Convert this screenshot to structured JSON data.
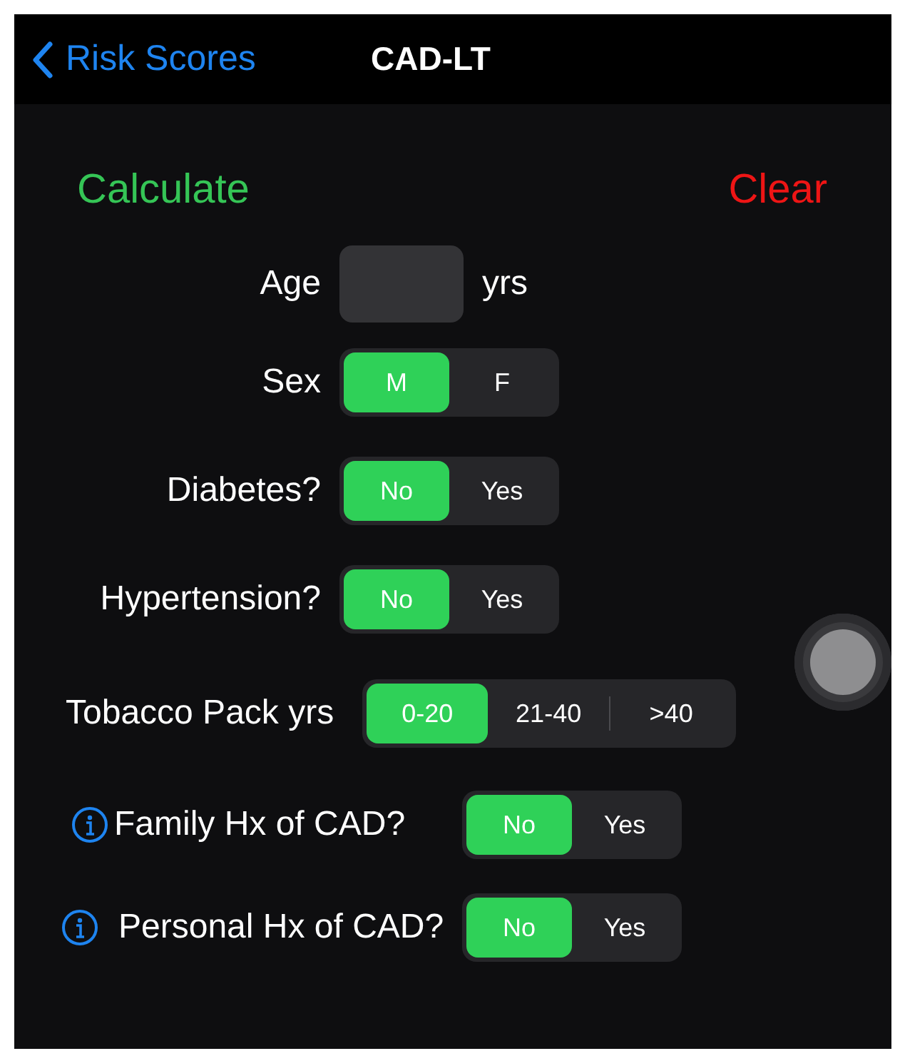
{
  "nav": {
    "back": "Risk Scores",
    "title": "CAD-LT"
  },
  "actions": {
    "calculate": "Calculate",
    "clear": "Clear"
  },
  "fields": [
    {
      "kind": "number",
      "label": "Age",
      "unit": "yrs"
    },
    {
      "kind": "segmented",
      "label": "Sex",
      "info": false,
      "options": [
        {
          "label": "M",
          "selected": true
        },
        {
          "label": "F",
          "selected": false
        }
      ]
    },
    {
      "kind": "segmented",
      "label": "Diabetes?",
      "info": false,
      "options": [
        {
          "label": "No",
          "selected": true
        },
        {
          "label": "Yes",
          "selected": false
        }
      ]
    },
    {
      "kind": "segmented",
      "label": "Hypertension?",
      "info": false,
      "options": [
        {
          "label": "No",
          "selected": true
        },
        {
          "label": "Yes",
          "selected": false
        }
      ]
    },
    {
      "kind": "wide",
      "label": "Tobacco Pack yrs",
      "info": false,
      "options": [
        {
          "label": "0-20",
          "selected": true
        },
        {
          "label": "21-40",
          "selected": false
        },
        {
          "label": ">40",
          "selected": false
        }
      ]
    },
    {
      "kind": "info",
      "label": "Family Hx of CAD?",
      "info": true,
      "options": [
        {
          "label": "No",
          "selected": true
        },
        {
          "label": "Yes",
          "selected": false
        }
      ]
    },
    {
      "kind": "info",
      "label": "Personal Hx of CAD?",
      "info": true,
      "options": [
        {
          "label": "No",
          "selected": true
        },
        {
          "label": "Yes",
          "selected": false
        }
      ]
    }
  ]
}
